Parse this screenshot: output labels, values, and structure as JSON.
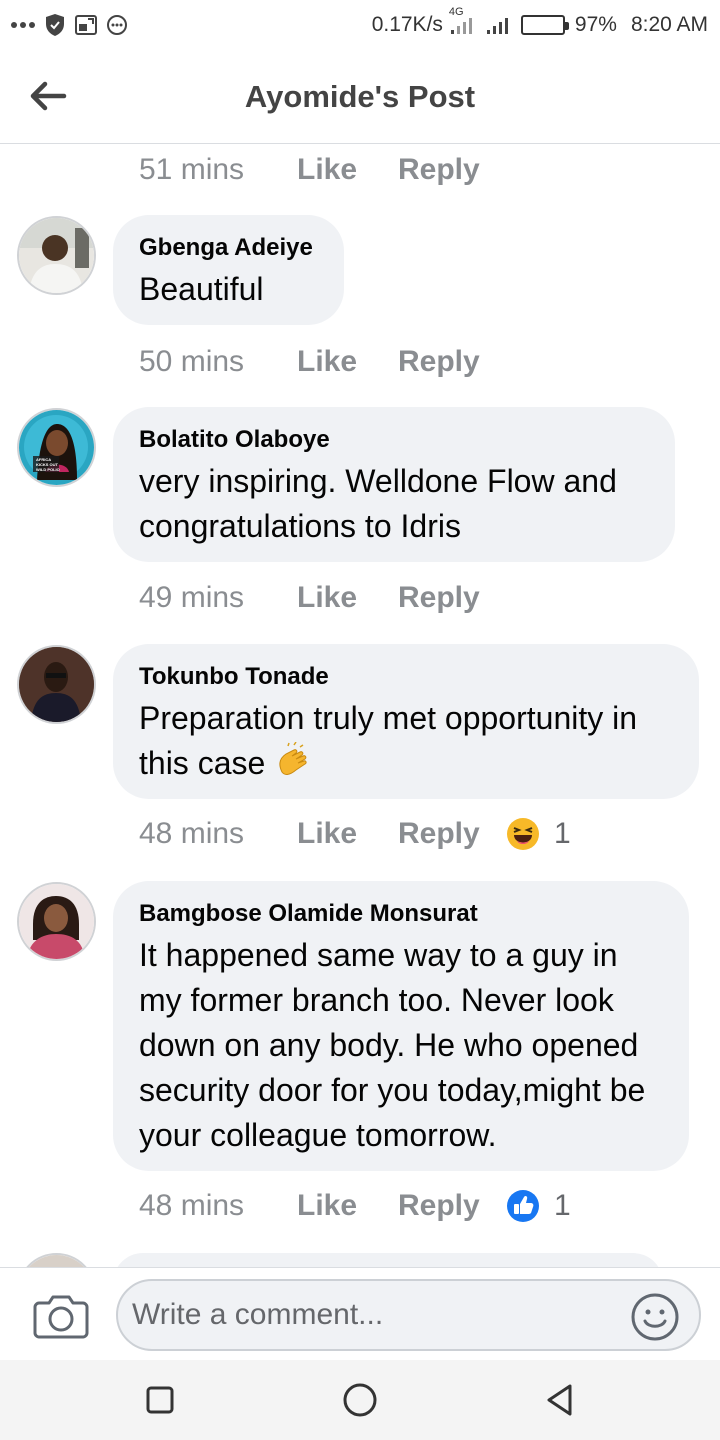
{
  "status_bar": {
    "speed": "0.17K/s",
    "network": "4G",
    "battery": "97%",
    "battery_level": 0.97,
    "time": "8:20 AM"
  },
  "header": {
    "title": "Ayomide's Post"
  },
  "actions": {
    "like": "Like",
    "reply": "Reply"
  },
  "top_meta": {
    "time": "51 mins"
  },
  "comments": [
    {
      "author": "Gbenga Adeiye",
      "text": "Beautiful",
      "time": "50 mins",
      "reaction_count": "",
      "reaction_icon": ""
    },
    {
      "author": "Bolatito Olaboye",
      "text": "very inspiring.  Welldone Flow and congratulations to Idris",
      "avatar_text": "AFRICA KICKS OUT WILD POLIO",
      "time": "49 mins",
      "reaction_count": "",
      "reaction_icon": ""
    },
    {
      "author": "Tokunbo Tonade",
      "text": "Preparation truly met opportunity in this case",
      "emoji": "clapping-hands",
      "time": "48 mins",
      "reaction_count": "1",
      "reaction_icon": "haha-reaction"
    },
    {
      "author": "Bamgbose Olamide Monsurat",
      "text": "It happened same way to a guy in my former branch too. Never look down on any body. He who opened security door for you today,might be your colleague tomorrow.",
      "time": "48 mins",
      "reaction_count": "1",
      "reaction_icon": "like-reaction"
    }
  ],
  "composer": {
    "placeholder": "Write a comment..."
  },
  "colors": {
    "bubble": "#f0f2f5",
    "meta": "#8a8d91",
    "like_blue": "#1877f2",
    "haha_yellow": "#f7b928"
  }
}
